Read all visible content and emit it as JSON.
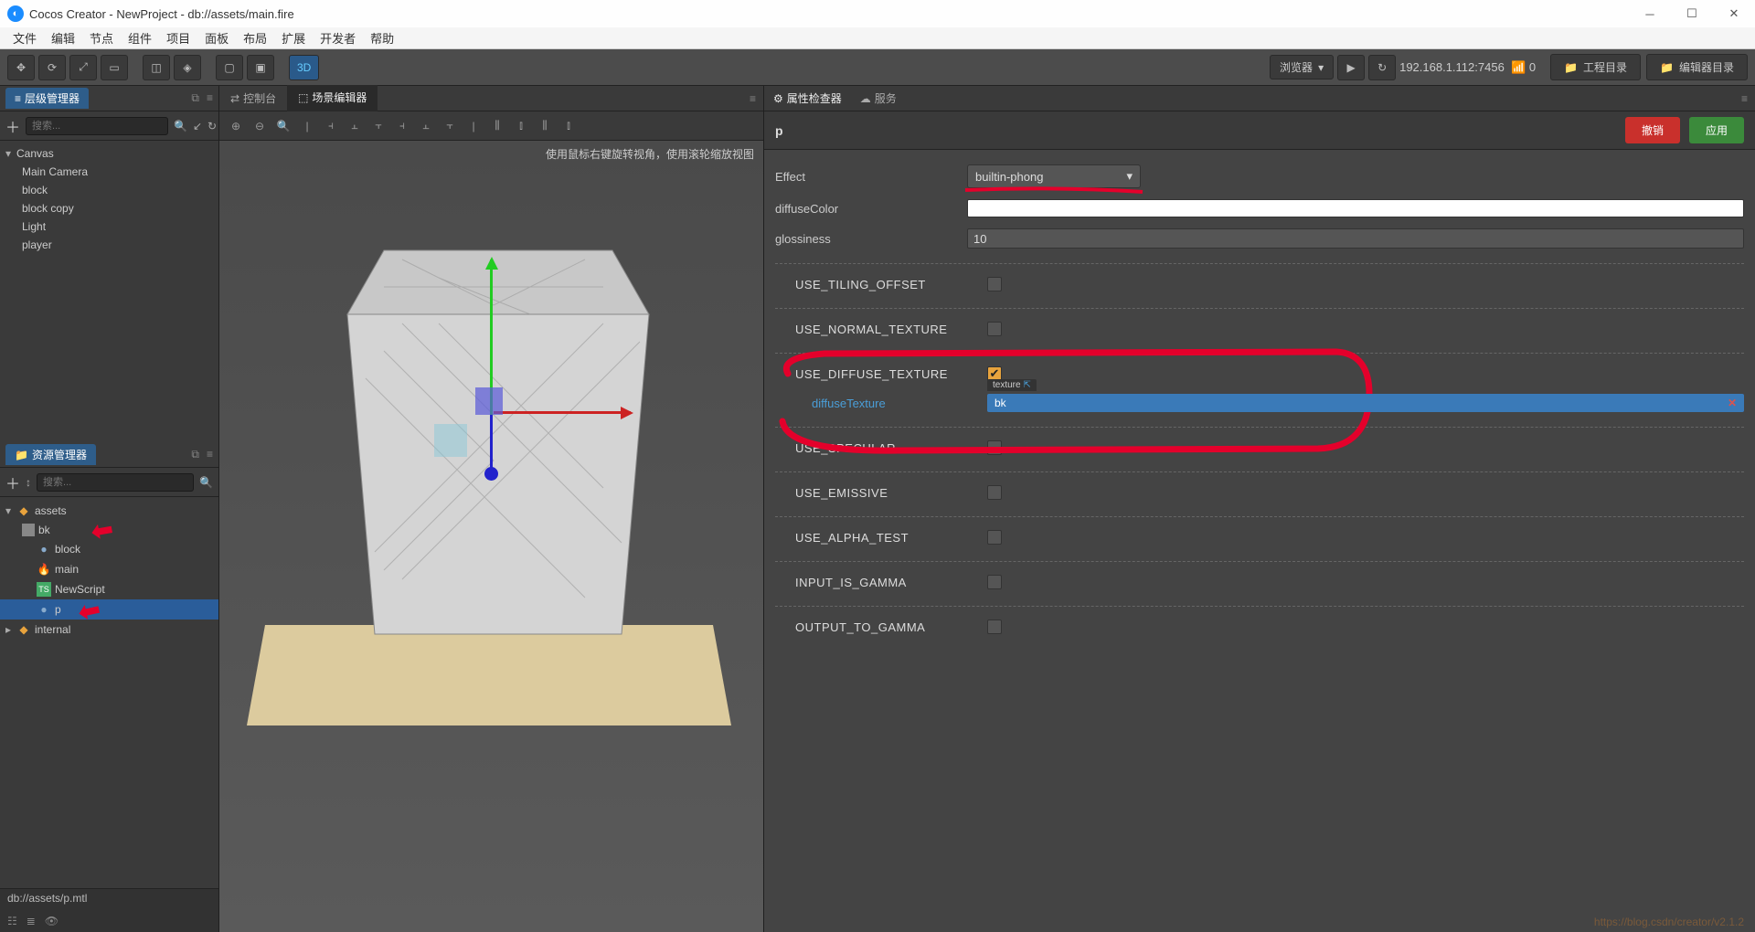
{
  "title": "Cocos Creator - NewProject - db://assets/main.fire",
  "menu": [
    "文件",
    "编辑",
    "节点",
    "组件",
    "项目",
    "面板",
    "布局",
    "扩展",
    "开发者",
    "帮助"
  ],
  "toolbar": {
    "browser": "浏览器",
    "ip": "192.168.1.112:7456",
    "proj_dir": "工程目录",
    "editor_dir": "编辑器目录",
    "mode3d": "3D"
  },
  "hierarchy": {
    "title": "层级管理器",
    "search_ph": "搜索...",
    "root": "Canvas",
    "items": [
      "Main Camera",
      "block",
      "block copy",
      "Light",
      "player"
    ]
  },
  "assets": {
    "title": "资源管理器",
    "search_ph": "搜索...",
    "root": "assets",
    "items": [
      {
        "name": "bk",
        "icon": "img",
        "expand": true
      },
      {
        "name": "block",
        "icon": "sphere"
      },
      {
        "name": "main",
        "icon": "fire"
      },
      {
        "name": "NewScript",
        "icon": "ts"
      },
      {
        "name": "p",
        "icon": "mtl",
        "selected": true
      }
    ],
    "internal": "internal",
    "path": "db://assets/p.mtl"
  },
  "scene": {
    "console_tab": "控制台",
    "scene_tab": "场景编辑器",
    "hint": "使用鼠标右键旋转视角，使用滚轮缩放视图"
  },
  "inspector": {
    "tab": "属性检查器",
    "services_tab": "服务",
    "name": "p",
    "revert": "撤销",
    "apply": "应用",
    "effect_lbl": "Effect",
    "effect_val": "builtin-phong",
    "diffuse_lbl": "diffuseColor",
    "gloss_lbl": "glossiness",
    "gloss_val": "10",
    "params": [
      {
        "key": "USE_TILING_OFFSET",
        "on": false
      },
      {
        "key": "USE_NORMAL_TEXTURE",
        "on": false
      },
      {
        "key": "USE_DIFFUSE_TEXTURE",
        "on": true
      },
      {
        "key": "USE_SPECULAR",
        "on": false
      },
      {
        "key": "USE_EMISSIVE",
        "on": false
      },
      {
        "key": "USE_ALPHA_TEST",
        "on": false
      },
      {
        "key": "INPUT_IS_GAMMA",
        "on": false
      },
      {
        "key": "OUTPUT_TO_GAMMA",
        "on": false
      }
    ],
    "diffuse_tex_lbl": "diffuseTexture",
    "texture_tag": "texture",
    "texture_val": "bk"
  },
  "footer": "https://blog.csdn/creator/v2.1.2"
}
